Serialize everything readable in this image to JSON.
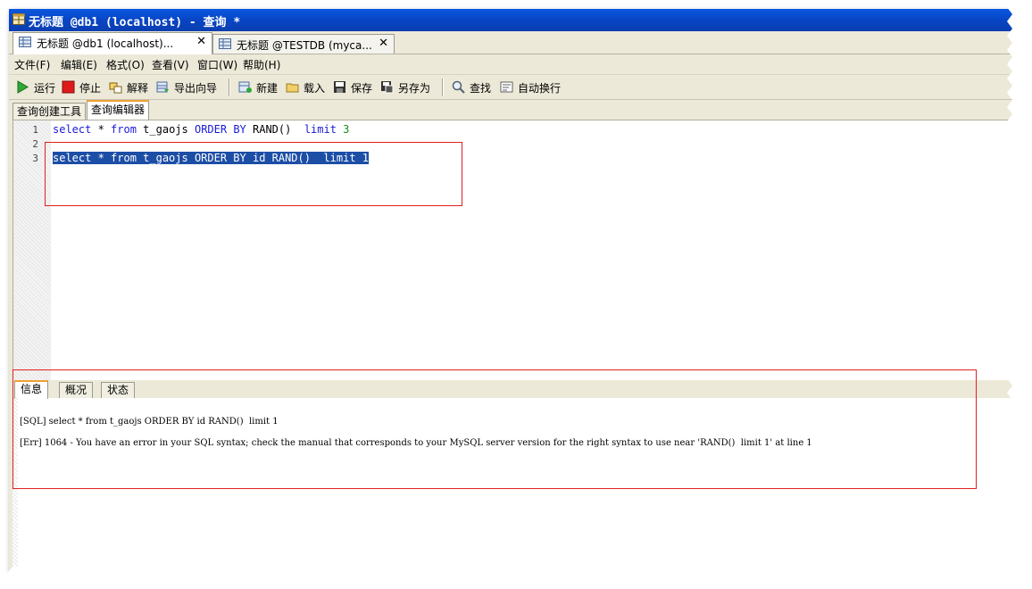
{
  "window": {
    "title": "无标题 @db1 (localhost) - 查询 *"
  },
  "doc_tabs": [
    {
      "label": "无标题 @db1 (localhost)...",
      "close": "✕"
    },
    {
      "label": "无标题 @TESTDB (myca...",
      "close": "✕"
    }
  ],
  "menu": [
    "文件(F)",
    "编辑(E)",
    "格式(O)",
    "查看(V)",
    "窗口(W)",
    "帮助(H)"
  ],
  "toolbar": {
    "run": "运行",
    "stop": "停止",
    "explain": "解释",
    "export": "导出向导",
    "new": "新建",
    "load": "载入",
    "save": "保存",
    "save_as": "另存为",
    "find": "查找",
    "word_wrap": "自动换行"
  },
  "sub_tabs": [
    "查询创建工具",
    "查询编辑器"
  ],
  "editor": {
    "line_numbers": [
      "1",
      "2",
      "3"
    ],
    "line1": {
      "select": "select",
      "star": " * ",
      "from": "from",
      "table": " t_gaojs ",
      "order": "ORDER BY",
      "rand": " RAND()  ",
      "limit": "limit",
      "num": " 3"
    },
    "line3": "select * from t_gaojs ORDER BY id RAND()  limit 1"
  },
  "results": {
    "tabs": [
      "信息",
      "概况",
      "状态"
    ],
    "sql_line": "[SQL] select * from t_gaojs ORDER BY id RAND()  limit 1",
    "err_line": "[Err] 1064 - You have an error in your SQL syntax; check the manual that corresponds to your MySQL server version for the right syntax to use near 'RAND()  limit 1' at line 1"
  },
  "colors": {
    "title_bar": "#0a58e0",
    "highlight": "#e02020",
    "selection": "#1c4ea6",
    "keyword": "#1a1ad8"
  }
}
